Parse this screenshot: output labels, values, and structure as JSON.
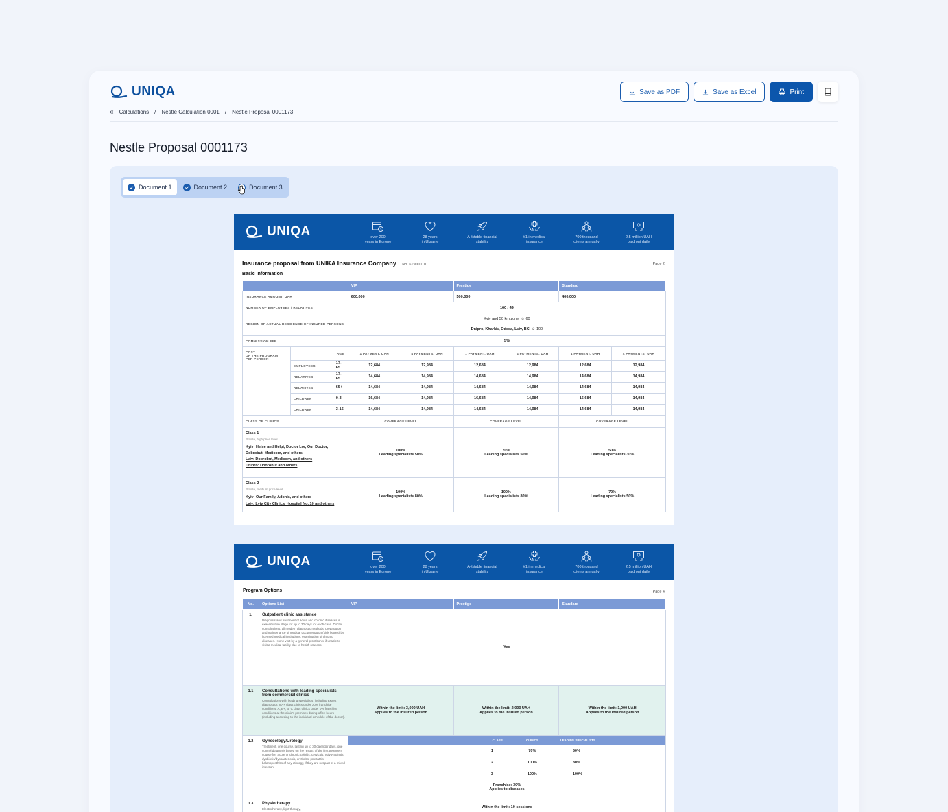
{
  "brand": {
    "name": "UNIQA"
  },
  "actions": {
    "save_pdf": "Save as PDF",
    "save_excel": "Save as Excel",
    "print": "Print"
  },
  "breadcrumb": [
    "Calculations",
    "Nestle Calculation 0001",
    "Nestle Proposal 0001173"
  ],
  "page_title": "Nestle Proposal 0001173",
  "tabs": [
    {
      "label": "Document 1",
      "checked": true
    },
    {
      "label": "Document 2",
      "checked": true
    },
    {
      "label": "Document 3",
      "checked": false
    }
  ],
  "features": [
    {
      "line1": "over 200",
      "line2": "years in Europe",
      "icon": "calendar-clock-icon"
    },
    {
      "line1": "28 years",
      "line2": "in Ukraine",
      "icon": "heart-icon"
    },
    {
      "line1": "A-/stable financial",
      "line2": "stability",
      "icon": "rocket-icon"
    },
    {
      "line1": "#1 in medical",
      "line2": "insurance",
      "icon": "medical-hands-icon"
    },
    {
      "line1": "700 thousand",
      "line2": "clients annually",
      "icon": "people-icon"
    },
    {
      "line1": "2.5 million UAH",
      "line2": "paid out daily",
      "icon": "money-icon"
    }
  ],
  "doc1": {
    "heading": "Insurance proposal from UNIKA Insurance Company",
    "number": "No. 61900010",
    "page": "Page 2",
    "section": "Basic Information",
    "columns": [
      "VIP",
      "Prestige",
      "Standard"
    ],
    "insurance_amount": {
      "label": "INSURANCE AMOUNT, UAH",
      "values": [
        "600,000",
        "500,000",
        "400,000"
      ]
    },
    "employees": {
      "label": "NUMBER OF EMPLOYEES / RELATIVES",
      "value": "160 / 49"
    },
    "region": {
      "label": "REGION OF ACTUAL RESIDENCE OF INSURED PERSONS",
      "line1": "Kyiv and 50 km zone",
      "count1": "60",
      "line2": "Dnipro, Kharkiv, Odesa, Lviv, BC",
      "count2": "100"
    },
    "commission": {
      "label": "COMMISSION FEE",
      "value": "5%"
    },
    "cost": {
      "label_lines": [
        "COST",
        "OF THE PROGRAM",
        "PER PERSON"
      ],
      "age_label": "AGE",
      "payment_cols": [
        "1 PAYMENT, UAH",
        "4 PAYMENTS, UAH",
        "1 PAYMENT, UAH",
        "4 PAYMENTS, UAH",
        "1 PAYMENT, UAH",
        "4 PAYMENTS, UAH"
      ],
      "rows": [
        {
          "group": "EMPLOYEES",
          "age": "17-65",
          "values": [
            "12,684",
            "12,984",
            "12,684",
            "12,984",
            "12,684",
            "12,984"
          ]
        },
        {
          "group": "RELATIVES",
          "age": "17-65",
          "values": [
            "14,684",
            "14,984",
            "14,684",
            "14,984",
            "14,684",
            "14,984"
          ]
        },
        {
          "group": "RELATIVES",
          "age": "65+",
          "values": [
            "14,684",
            "14,984",
            "14,684",
            "14,984",
            "14,684",
            "14,984"
          ]
        },
        {
          "group": "CHILDREN",
          "age": "0-3",
          "values": [
            "16,684",
            "14,984",
            "16,684",
            "14,984",
            "16,684",
            "14,984"
          ]
        },
        {
          "group": "CHILDREN",
          "age": "3-16",
          "values": [
            "14,684",
            "14,984",
            "14,684",
            "14,984",
            "14,684",
            "14,984"
          ]
        }
      ]
    },
    "clinics": {
      "label": "CLASS OF CLINICS",
      "coverage_label": "COVERAGE LEVEL",
      "class1": {
        "title": "Class 1",
        "sub": "Private, high price level",
        "links": [
          "Kyiv: Helse and Helpi, Doctor Lor, Our Doctor, Dobrobut, Medicom, and others",
          "Lviv: Dobrobut, Medicom, and others",
          "Dnipro: Dobrobut and others"
        ],
        "values": [
          [
            "100%",
            "Leading specialists 50%"
          ],
          [
            "70%",
            "Leading specialists 50%"
          ],
          [
            "50%",
            "Leading specialists 30%"
          ]
        ]
      },
      "class2": {
        "title": "Class 2",
        "sub": "Private, medium price level",
        "links": [
          "Kyiv: Our Family, Adonis, and others",
          "Lviv: Lviv City Clinical Hospital No. 10 and others"
        ],
        "values": [
          [
            "100%",
            "Leading specialists 80%"
          ],
          [
            "100%",
            "Leading specialists 80%"
          ],
          [
            "70%",
            "Leading specialists 50%"
          ]
        ]
      }
    }
  },
  "doc2": {
    "heading": "Program Options",
    "page": "Page 4",
    "columns": [
      "No.",
      "Options List",
      "VIP",
      "Prestige",
      "Standard"
    ],
    "rows": [
      {
        "no": "1.",
        "title": "Outpatient clinic assistance",
        "desc": "Diagnosis and treatment of acute and chronic diseases in exacerbation stage for up to 30 days for each case. Doctor consultations; all modern diagnostic methods; preparation and maintenance of medical documentation (sick leaves) by licensed medical institutions, examination of chronic diseases. Home visit by a general practitioner if unable to visit a medical facility due to health reasons.",
        "value": "Yes"
      },
      {
        "no": "1.1",
        "title": "Consultations with leading specialists from commercial clinics",
        "desc": "Consultations with leading specialists, including expert diagnostics in A+ class clinics under 30% franchise conditions. A, B+, B, C class clinics under 0% franchise conditions at the clinic's premises during office hours (including according to the individual schedule of the doctor).",
        "values": [
          [
            "Within the limit: 3,000 UAH",
            "Applies to the insured person"
          ],
          [
            "Within the limit: 2,000 UAH",
            "Applies to the insured person"
          ],
          [
            "Within the limit: 1,000 UAH",
            "Applies to the insured person"
          ]
        ]
      },
      {
        "no": "1.2",
        "title": "Gynecology/Urology",
        "desc": "Treatment, one course, lasting up to 30 calendar days, one control diagnosis based on the results of the first treatment course for: acute or chronic colpitis, cervicitis, vulvovaginitis, dysbiosis/dysbacteriosis, urethritis, prostatitis, balanoposthitis of any etiology, if they are not part of a mixed infection.",
        "sub_cols": [
          "CLASS",
          "CLINICS",
          "LEADING SPECIALISTS"
        ],
        "sub_rows": [
          [
            "1",
            "70%",
            "50%"
          ],
          [
            "2",
            "100%",
            "80%"
          ],
          [
            "3",
            "100%",
            "100%"
          ]
        ],
        "franchise": [
          "Franchise: 30%",
          "Applies to diseases"
        ]
      },
      {
        "no": "1.3",
        "title": "Physiotherapy",
        "desc": "Electrotherapy, light therapy,",
        "value": "Within the limit: 10 sessions"
      }
    ]
  }
}
